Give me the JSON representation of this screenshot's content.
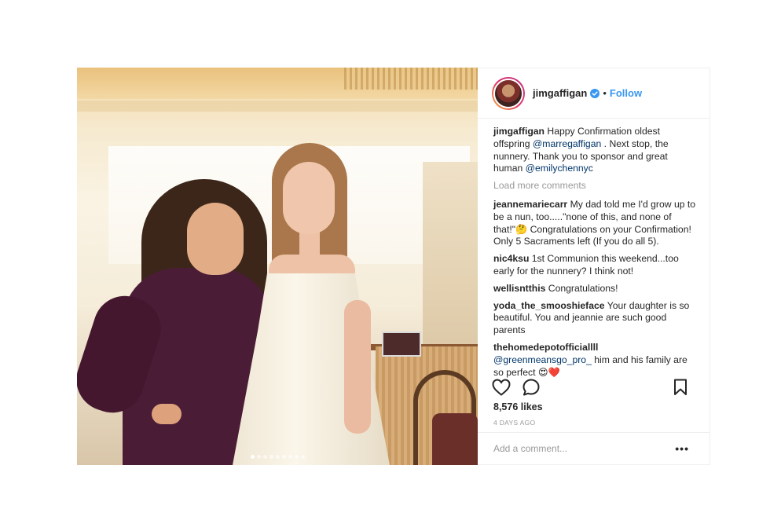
{
  "post": {
    "username": "jimgaffigan",
    "separator": "•",
    "follow_label": "Follow",
    "caption": {
      "user": "jimgaffigan",
      "text_1": " Happy Confirmation oldest offspring ",
      "mention_1": "@marregaffigan",
      "text_2": " . Next stop, the nunnery. Thank you to sponsor and great human ",
      "mention_2": "@emilychennyc"
    },
    "load_more_label": "Load more comments",
    "comments": [
      {
        "user": "jeannemariecarr",
        "text": " My dad told me I'd grow up to be a nun, too.....\"none of this, and none of that!\"🤔 Congratulations on your Confirmation! Only 5 Sacraments left (If you do all 5)."
      },
      {
        "user": "nic4ksu",
        "text": " 1st Communion this weekend...too early for the nunnery? I think not!"
      },
      {
        "user": "wellisntthis",
        "text": " Congratulations!"
      },
      {
        "user": "yoda_the_smooshieface",
        "text": " Your daughter is so beautiful. You and jeannie are such good parents"
      }
    ],
    "last_comment": {
      "user": "thehomedepotofficiallll",
      "mention": " @greenmeansgo_pro_",
      "text": " him and his family are so perfect 😍❤️"
    },
    "likes": "8,576 likes",
    "date": "4 DAYS AGO",
    "add_comment_placeholder": "Add a comment...",
    "more_label": "•••"
  },
  "carousel": {
    "count": 9,
    "active_index": 0
  },
  "icons": {
    "verified": "verified-badge-icon",
    "like": "heart-icon",
    "comment": "comment-bubble-icon",
    "save": "bookmark-icon"
  },
  "colors": {
    "link": "#3897f0",
    "mention": "#003569",
    "muted": "#999999",
    "verified": "#3897f0"
  }
}
